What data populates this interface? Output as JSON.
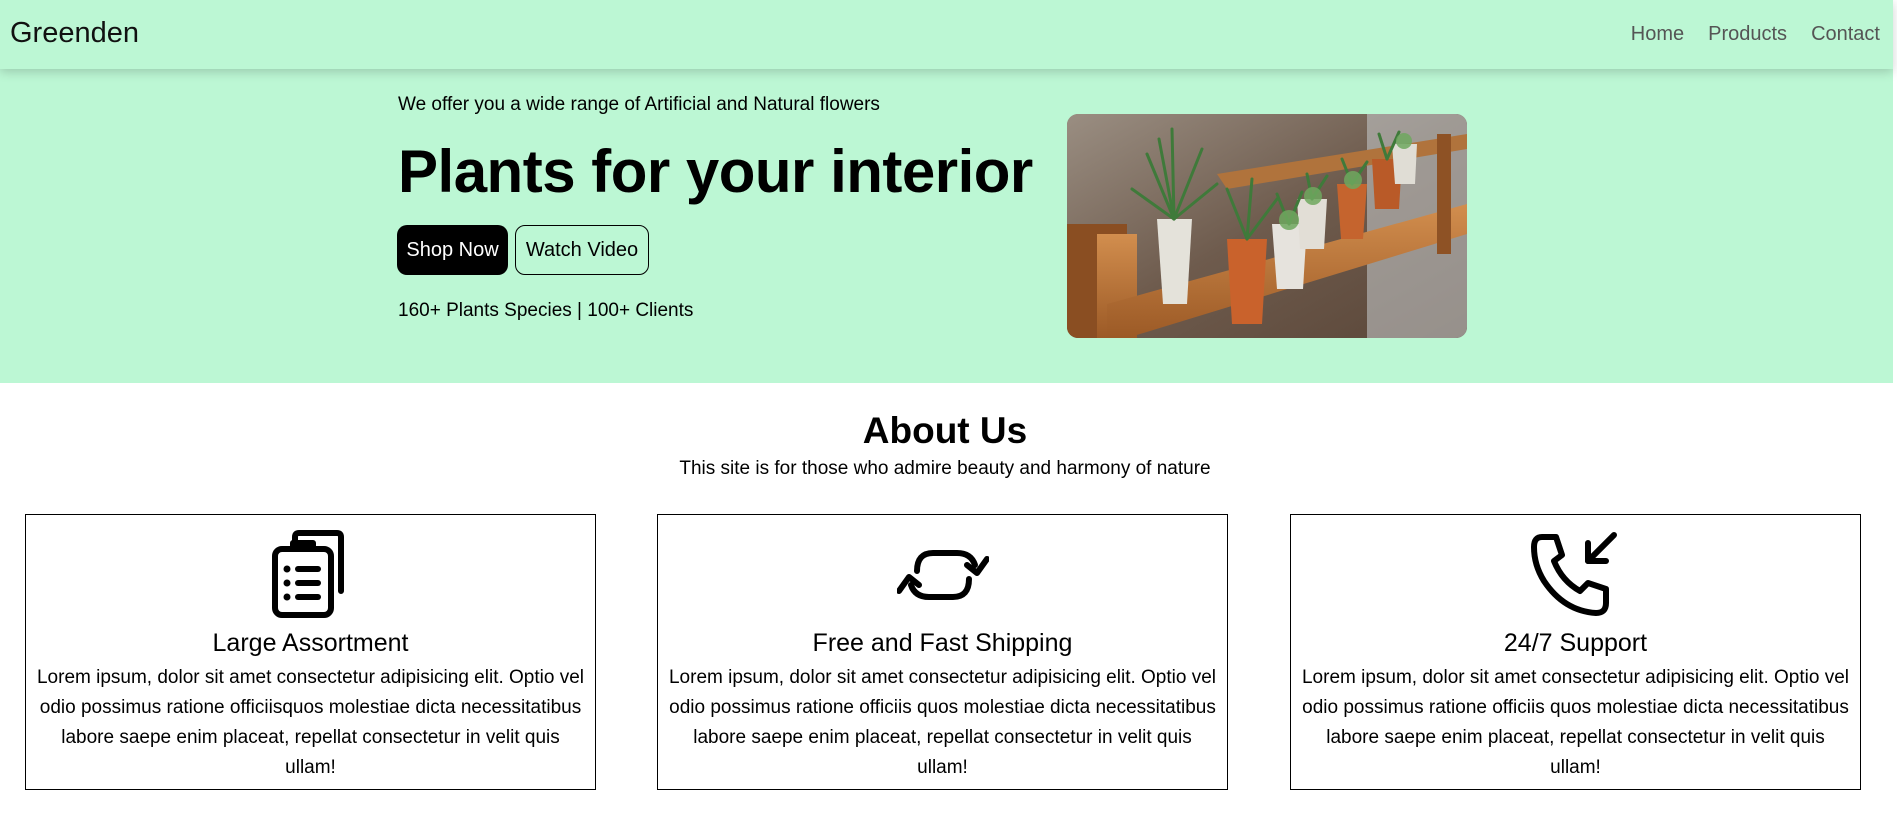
{
  "navbar": {
    "brand": "Greenden",
    "links": [
      "Home",
      "Products",
      "Contact"
    ]
  },
  "hero": {
    "subtitle": "We offer you a wide range of Artificial and Natural flowers",
    "title": "Plants for your interior",
    "shop_button": "Shop Now",
    "video_button": "Watch Video",
    "stats": "160+ Plants Species | 100+ Clients"
  },
  "about": {
    "title": "About Us",
    "subtitle": "This site is for those who admire beauty and harmony of nature",
    "cards": [
      {
        "icon": "clipboard-list-icon",
        "title": "Large Assortment",
        "text": "Lorem ipsum, dolor sit amet consectetur adipisicing elit. Optio vel odio possimus ratione officiisquos molestiae dicta necessitatibus labore saepe enim placeat, repellat consectetur in velit quis ullam!"
      },
      {
        "icon": "refresh-arrows-icon",
        "title": "Free and Fast Shipping",
        "text": "Lorem ipsum, dolor sit amet consectetur adipisicing elit. Optio vel odio possimus ratione officiis quos molestiae dicta necessitatibus labore saepe enim placeat, repellat consectetur in velit quis ullam!"
      },
      {
        "icon": "phone-incoming-icon",
        "title": "24/7 Support",
        "text": "Lorem ipsum, dolor sit amet consectetur adipisicing elit. Optio vel odio possimus ratione officiis quos molestiae dicta necessitatibus labore saepe enim placeat, repellat consectetur in velit quis ullam!"
      }
    ]
  },
  "colors": {
    "mint_background": "#bcf7d4",
    "primary_button": "#000000"
  }
}
